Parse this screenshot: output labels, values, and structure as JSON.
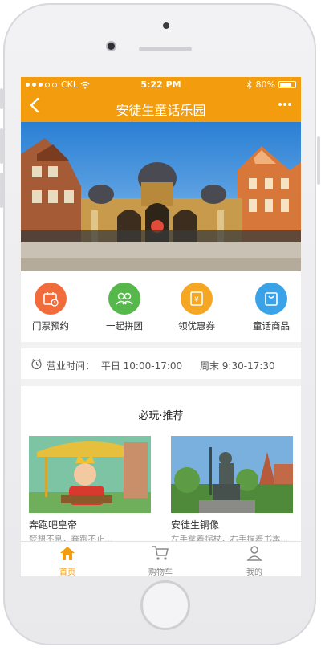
{
  "status_bar": {
    "carrier": "CKL",
    "time": "5:22 PM",
    "battery": "80%",
    "battery_level": 0.8
  },
  "nav": {
    "title": "安徒生童话乐园",
    "back_icon": "chevron-left-icon",
    "more_icon": "more-dots-icon"
  },
  "quick_actions": [
    {
      "label": "门票预约",
      "icon": "ticket-calendar-icon",
      "color": "#f26b3a"
    },
    {
      "label": "一起拼团",
      "icon": "group-icon",
      "color": "#56b84a"
    },
    {
      "label": "领优惠券",
      "icon": "coupon-icon",
      "color": "#f5a623"
    },
    {
      "label": "童话商品",
      "icon": "shopping-bag-icon",
      "color": "#3aa3e8"
    }
  ],
  "hours": {
    "label": "营业时间：",
    "weekday": "平日 10:00-17:00",
    "weekend": "周末 9:30-17:30"
  },
  "recommend": {
    "title": "必玩·推荐",
    "items": [
      {
        "name": "奔跑吧皇帝",
        "desc": "梦想不息，奔跑不止..."
      },
      {
        "name": "安徒生铜像",
        "desc": "左手拿着拐杖，右手握着书本..."
      }
    ]
  },
  "tabs": [
    {
      "label": "首页",
      "icon": "home-icon",
      "active": true
    },
    {
      "label": "购物车",
      "icon": "cart-icon",
      "active": false
    },
    {
      "label": "我的",
      "icon": "user-icon",
      "active": false
    }
  ],
  "colors": {
    "accent": "#f39c0e",
    "inactive_tab": "#888888"
  }
}
